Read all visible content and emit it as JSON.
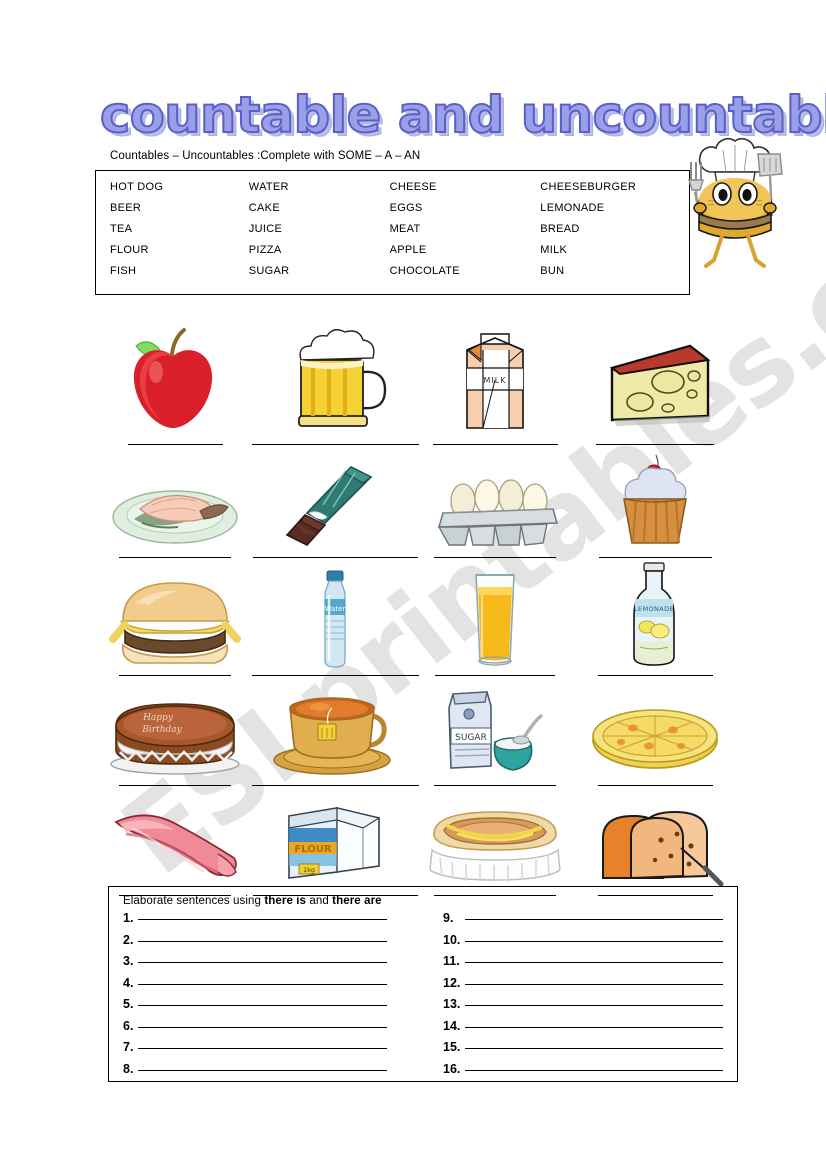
{
  "title": "countable and uncountables",
  "instruction": "Countables – Uncountables :Complete with SOME – A – AN",
  "watermark": "ESLprintables.com",
  "colors": {
    "title_fill": "#9aa0e8",
    "title_outline": "#5b5fc7",
    "border": "#000000"
  },
  "word_table": {
    "rows": [
      [
        "HOT DOG",
        "WATER",
        "CHEESE",
        "CHEESEBURGER"
      ],
      [
        "BEER",
        "CAKE",
        "EGGS",
        "LEMONADE"
      ],
      [
        "TEA",
        "JUICE",
        "MEAT",
        "BREAD"
      ],
      [
        "FLOUR",
        "PIZZA",
        "APPLE",
        "MILK"
      ],
      [
        "FISH",
        "SUGAR",
        "CHOCOLATE",
        "BUN"
      ]
    ]
  },
  "mascot": {
    "name": "chef-bee-burger",
    "hat": "chef-hat",
    "left_tool": "fork",
    "right_tool": "spatula"
  },
  "picture_grid": {
    "rows": [
      [
        {
          "icon": "apple-icon",
          "label": "apple",
          "line_width": 95
        },
        {
          "icon": "beer-mug-icon",
          "label": "beer",
          "line_width": 167
        },
        {
          "icon": "milk-carton-icon",
          "label": "milk",
          "line_width": 125,
          "text_on_art": "MILK"
        },
        {
          "icon": "cheese-wedge-icon",
          "label": "cheese",
          "line_width": 118
        }
      ],
      [
        {
          "icon": "fish-plate-icon",
          "label": "fish",
          "line_width": 112
        },
        {
          "icon": "chocolate-bar-icon",
          "label": "chocolate",
          "line_width": 165
        },
        {
          "icon": "egg-carton-icon",
          "label": "eggs",
          "line_width": 122
        },
        {
          "icon": "cupcake-icon",
          "label": "cake",
          "line_width": 113
        }
      ],
      [
        {
          "icon": "cheeseburger-icon",
          "label": "cheeseburger",
          "line_width": 112
        },
        {
          "icon": "water-bottle-icon",
          "label": "water",
          "line_width": 167,
          "text_on_art": "Water"
        },
        {
          "icon": "juice-glass-icon",
          "label": "juice",
          "line_width": 120
        },
        {
          "icon": "lemonade-bottle-icon",
          "label": "lemonade",
          "line_width": 115,
          "text_on_art": "LEMONADE"
        }
      ],
      [
        {
          "icon": "birthday-cake-icon",
          "label": "cake",
          "line_width": 112,
          "text_on_art": "Happy Birthday"
        },
        {
          "icon": "tea-cup-icon",
          "label": "tea",
          "line_width": 167
        },
        {
          "icon": "sugar-bag-icon",
          "label": "sugar",
          "line_width": 122,
          "text_on_art": "SUGAR"
        },
        {
          "icon": "pizza-icon",
          "label": "pizza",
          "line_width": 115
        }
      ],
      [
        {
          "icon": "meat-icon",
          "label": "meat",
          "line_width": 112
        },
        {
          "icon": "flour-package-icon",
          "label": "flour",
          "line_width": 165,
          "text_on_art": "FLOUR 1kg"
        },
        {
          "icon": "hot-dog-icon",
          "label": "hot dog",
          "line_width": 122
        },
        {
          "icon": "bread-icon",
          "label": "bread",
          "line_width": 115
        }
      ]
    ]
  },
  "exercise": {
    "title_prefix": "Elaborate sentences using",
    "title_bold_1": "there is",
    "title_mid": "and",
    "title_bold_2": "there are",
    "left_numbers": [
      "1.",
      "2.",
      "3.",
      "4.",
      "5.",
      "6.",
      "7.",
      "8."
    ],
    "right_numbers": [
      "9.",
      "10.",
      "11.",
      "12.",
      "13.",
      "14.",
      "15.",
      "16."
    ]
  }
}
